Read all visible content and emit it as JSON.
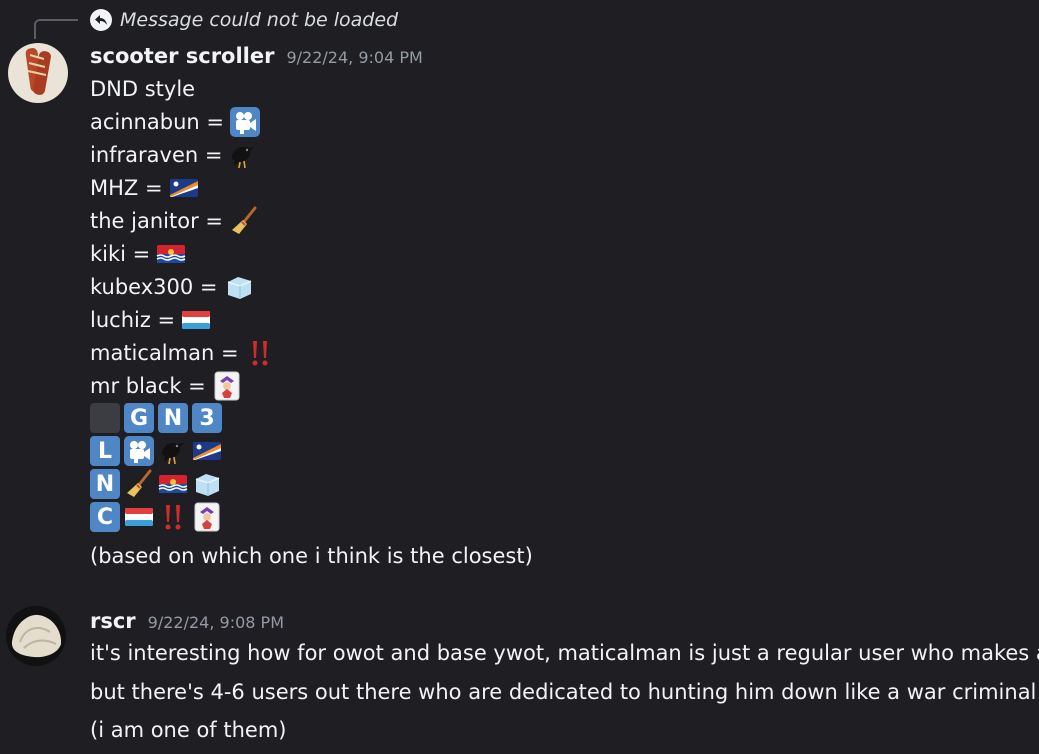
{
  "reply": {
    "text": "Message could not be loaded"
  },
  "message1": {
    "author": "scooter scroller",
    "timestamp": "9/22/24, 9:04 PM",
    "title": "DND style",
    "mappings": [
      {
        "label": "acinnabun =",
        "emoji": "movie-camera-icon"
      },
      {
        "label": "infraraven =",
        "emoji": "black-bird-icon"
      },
      {
        "label": "MHZ =",
        "emoji": "marshall-islands-flag-icon"
      },
      {
        "label": "the janitor =",
        "emoji": "broom-icon"
      },
      {
        "label": "kiki =",
        "emoji": "kiribati-flag-icon"
      },
      {
        "label": "kubex300 =",
        "emoji": "ice-cube-icon"
      },
      {
        "label": "luchiz =",
        "emoji": "luxembourg-flag-icon"
      },
      {
        "label": "maticalman =",
        "emoji": "double-exclamation-icon"
      },
      {
        "label": "mr black =",
        "emoji": "joker-card-icon"
      }
    ],
    "grid": {
      "tiles": [
        "G",
        "N",
        "3",
        "L",
        "N",
        "C"
      ]
    },
    "footer": "(based on which one i think is the closest)"
  },
  "message2": {
    "author": "rscr",
    "timestamp": "9/22/24, 9:08 PM",
    "lines": [
      "it's interesting how for owot and base ywot, maticalman is just a regular user who makes art",
      "but there's 4-6 users out there who are dedicated to hunting him down like a war criminal",
      "(i am one of them)"
    ]
  },
  "colors": {
    "background": "#1f1f23",
    "tile": "#4f86c6",
    "timestamp": "#949ba4"
  }
}
